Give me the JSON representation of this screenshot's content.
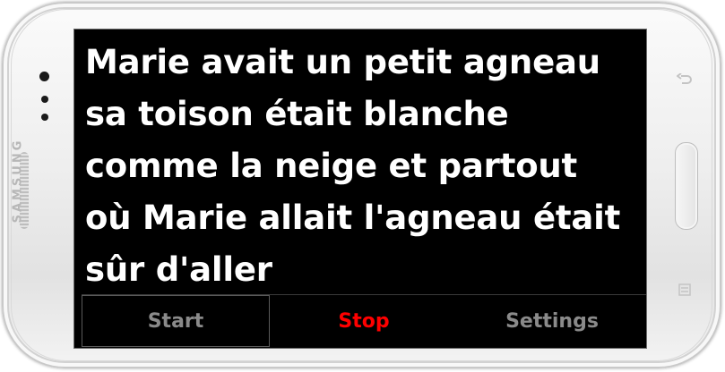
{
  "device": {
    "brand_label": "SAMSUNG"
  },
  "screen": {
    "lyrics_lines": [
      "Marie avait un petit agneau",
      "sa toison était blanche",
      "comme la neige et partout",
      "où Marie allait l'agneau était",
      "sûr d'aller"
    ]
  },
  "buttons": {
    "start_label": "Start",
    "stop_label": "Stop",
    "settings_label": "Settings"
  },
  "colors": {
    "screen_background": "#000000",
    "text": "#ffffff",
    "stop_accent": "#ff0000",
    "inactive_button": "#8a8a8a"
  },
  "icons": {
    "back_key": "back-arrow-icon",
    "menu_key": "menu-icon"
  }
}
